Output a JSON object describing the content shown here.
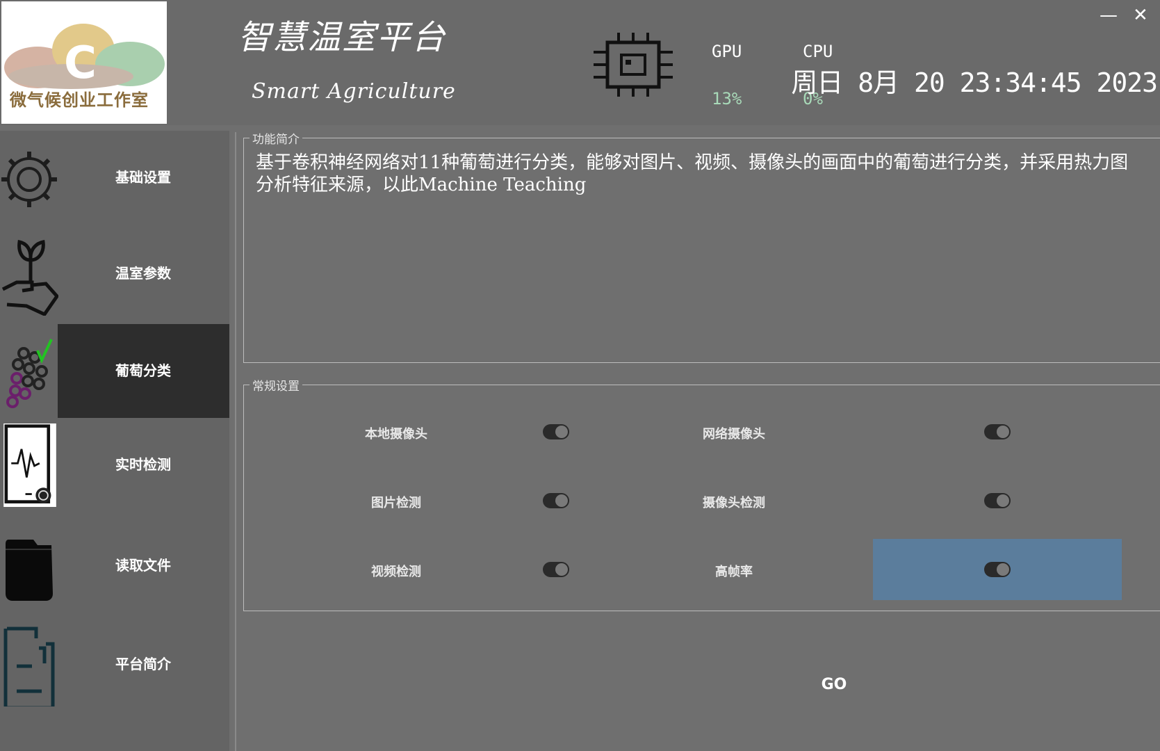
{
  "header": {
    "logo_text": "微气候创业工作室",
    "logo_letter": "C",
    "title": "智慧温室平台",
    "subtitle": "Smart Agriculture",
    "gpu_label": "GPU",
    "gpu_value": "13%",
    "cpu_label": "CPU",
    "cpu_value": "0%",
    "datetime": "周日 8月 20 23:34:45 2023",
    "minimize_label": "—",
    "close_label": "✕"
  },
  "sidebar": {
    "items": [
      {
        "label": "基础设置",
        "icon": "gear-icon"
      },
      {
        "label": "温室参数",
        "icon": "plant-in-hand-icon"
      },
      {
        "label": "葡萄分类",
        "icon": "grapes-icon",
        "active": true
      },
      {
        "label": "实时检测",
        "icon": "monitor-pulse-icon"
      },
      {
        "label": "读取文件",
        "icon": "folder-icon"
      },
      {
        "label": "平台简介",
        "icon": "document-icon"
      }
    ]
  },
  "intro": {
    "legend": "功能简介",
    "text": "基于卷积神经网络对11种葡萄进行分类，能够对图片、视频、摄像头的画面中的葡萄进行分类，并采用热力图分析特征来源，以此Machine Teaching"
  },
  "settings": {
    "legend": "常规设置",
    "items": [
      {
        "label": "本地摄像头",
        "on": true
      },
      {
        "label": "网络摄像头",
        "on": true
      },
      {
        "label": "图片检测",
        "on": true
      },
      {
        "label": "摄像头检测",
        "on": true
      },
      {
        "label": "视频检测",
        "on": true
      },
      {
        "label": "高帧率",
        "on": true
      }
    ]
  },
  "go_label": "GO",
  "colors": {
    "background": "#6f6f6f",
    "sidebar": "#646464",
    "active_item": "#2d2d2d",
    "highlight": "#5b7d9c",
    "stat_value": "#a8d9b8"
  }
}
